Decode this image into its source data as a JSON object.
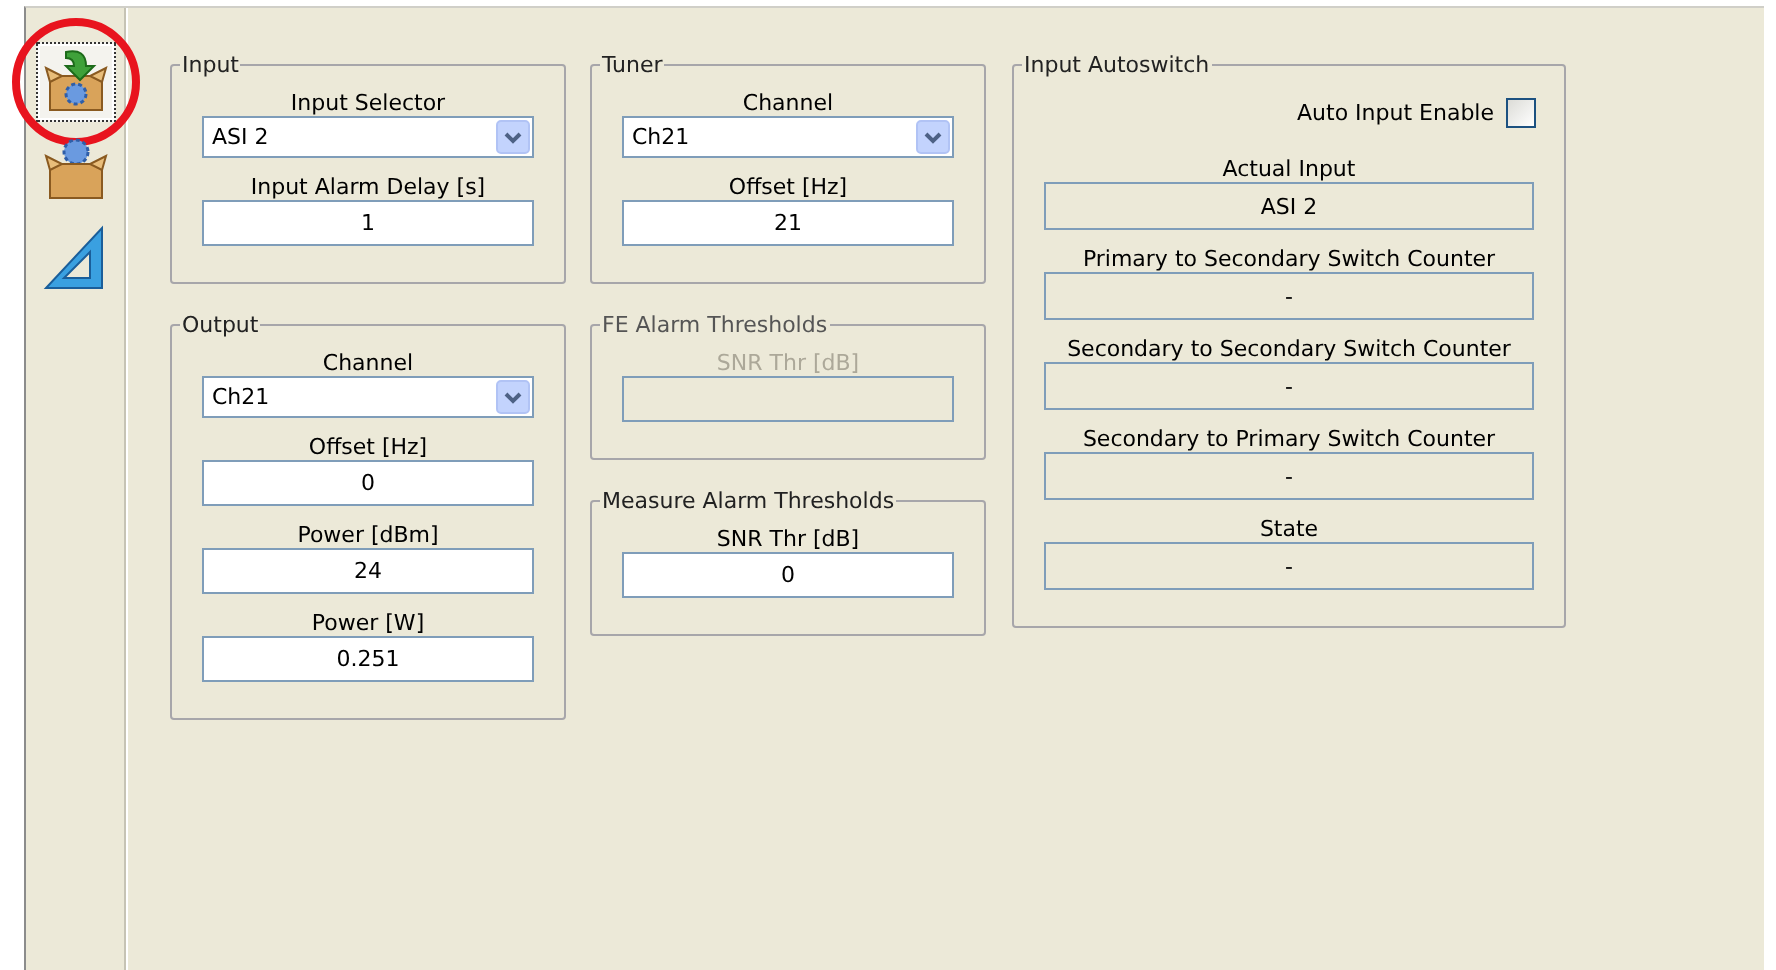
{
  "sidebar": {
    "items": [
      {
        "kind": "box-arrow",
        "selected": true,
        "annotated": true
      },
      {
        "kind": "box-gear",
        "selected": false,
        "annotated": false
      },
      {
        "kind": "triangle",
        "selected": false,
        "annotated": false
      }
    ]
  },
  "columns": [
    [
      {
        "title": "Input",
        "disabled": false,
        "fields": [
          {
            "kind": "dropdown",
            "label": "Input Selector",
            "selection": "ASI 2"
          },
          {
            "kind": "input",
            "label": "Input Alarm Delay [s]",
            "value": "1"
          }
        ]
      },
      {
        "title": "Output",
        "disabled": false,
        "fields": [
          {
            "kind": "dropdown",
            "label": "Channel",
            "selection": "Ch21"
          },
          {
            "kind": "input",
            "label": "Offset [Hz]",
            "value": "0"
          },
          {
            "kind": "input",
            "label": "Power [dBm]",
            "value": "24"
          },
          {
            "kind": "input",
            "label": "Power [W]",
            "value": "0.251"
          }
        ]
      }
    ],
    [
      {
        "title": "Tuner",
        "disabled": false,
        "fields": [
          {
            "kind": "dropdown",
            "label": "Channel",
            "selection": "Ch21"
          },
          {
            "kind": "input",
            "label": "Offset [Hz]",
            "value": "21"
          }
        ]
      },
      {
        "title": "FE Alarm Thresholds",
        "disabled": true,
        "fields": [
          {
            "kind": "input",
            "label": "SNR Thr [dB]"
          }
        ]
      },
      {
        "title": "Measure Alarm Thresholds",
        "disabled": false,
        "fields": [
          {
            "kind": "input",
            "label": "SNR Thr [dB]",
            "value": "0"
          }
        ]
      }
    ],
    [
      {
        "title": "Input Autoswitch",
        "disabled": false,
        "fields": [
          {
            "kind": "checkbox",
            "label": "Auto Input Enable",
            "checked": false
          },
          {
            "kind": "readonly",
            "label": "Actual Input",
            "value": "ASI 2"
          },
          {
            "kind": "readonly",
            "label": "Primary to Secondary Switch Counter",
            "value": "-"
          },
          {
            "kind": "readonly",
            "label": "Secondary to Secondary Switch Counter",
            "value": "-"
          },
          {
            "kind": "readonly",
            "label": "Secondary to Primary Switch Counter",
            "value": "-"
          },
          {
            "kind": "readonly",
            "label": "State",
            "value": "-"
          }
        ]
      }
    ]
  ]
}
